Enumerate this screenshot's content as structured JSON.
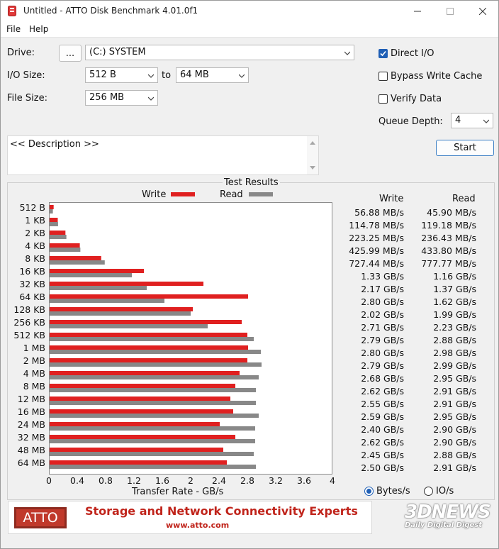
{
  "window": {
    "title": "Untitled - ATTO Disk Benchmark 4.01.0f1"
  },
  "menu": [
    "File",
    "Help"
  ],
  "settings": {
    "drive_label": "Drive:",
    "drive_browse": "...",
    "drive_value": "(C:) SYSTEM",
    "io_size_label": "I/O Size:",
    "io_from": "512 B",
    "io_to_label": "to",
    "io_to": "64 MB",
    "file_size_label": "File Size:",
    "file_size": "256 MB",
    "direct_io": "Direct I/O",
    "bypass_write_cache": "Bypass Write Cache",
    "verify_data": "Verify Data",
    "queue_depth_label": "Queue Depth:",
    "queue_depth": "4",
    "start": "Start",
    "description": "<< Description >>"
  },
  "results": {
    "title": "Test Results",
    "write_col": "Write",
    "read_col": "Read",
    "legend_write": "Write",
    "legend_read": "Read",
    "write_color": "#e02020",
    "read_color": "#888888",
    "x_label": "Transfer Rate - GB/s",
    "units_bytes": "Bytes/s",
    "units_io": "IO/s"
  },
  "chart_data": {
    "type": "bar",
    "orientation": "horizontal",
    "xlim": [
      0,
      4
    ],
    "xticks": [
      "0",
      "0.4",
      "0.8",
      "1.2",
      "1.6",
      "2",
      "2.4",
      "2.8",
      "3.2",
      "3.6",
      "4"
    ],
    "xlabel": "Transfer Rate - GB/s",
    "categories": [
      "512 B",
      "1 KB",
      "2 KB",
      "4 KB",
      "8 KB",
      "16 KB",
      "32 KB",
      "64 KB",
      "128 KB",
      "256 KB",
      "512 KB",
      "1 MB",
      "2 MB",
      "4 MB",
      "8 MB",
      "12 MB",
      "16 MB",
      "24 MB",
      "32 MB",
      "48 MB",
      "64 MB"
    ],
    "series": [
      {
        "name": "Write",
        "values": [
          0.05688,
          0.11478,
          0.22325,
          0.42599,
          0.72744,
          1.33,
          2.17,
          2.8,
          2.02,
          2.71,
          2.79,
          2.8,
          2.79,
          2.68,
          2.62,
          2.55,
          2.59,
          2.4,
          2.62,
          2.45,
          2.5
        ],
        "labels": [
          "56.88 MB/s",
          "114.78 MB/s",
          "223.25 MB/s",
          "425.99 MB/s",
          "727.44 MB/s",
          "1.33 GB/s",
          "2.17 GB/s",
          "2.80 GB/s",
          "2.02 GB/s",
          "2.71 GB/s",
          "2.79 GB/s",
          "2.80 GB/s",
          "2.79 GB/s",
          "2.68 GB/s",
          "2.62 GB/s",
          "2.55 GB/s",
          "2.59 GB/s",
          "2.40 GB/s",
          "2.62 GB/s",
          "2.45 GB/s",
          "2.50 GB/s"
        ]
      },
      {
        "name": "Read",
        "values": [
          0.0459,
          0.11918,
          0.23643,
          0.4338,
          0.77777,
          1.16,
          1.37,
          1.62,
          1.99,
          2.23,
          2.88,
          2.98,
          2.99,
          2.95,
          2.91,
          2.91,
          2.95,
          2.9,
          2.9,
          2.88,
          2.91
        ],
        "labels": [
          "45.90 MB/s",
          "119.18 MB/s",
          "236.43 MB/s",
          "433.80 MB/s",
          "777.77 MB/s",
          "1.16 GB/s",
          "1.37 GB/s",
          "1.62 GB/s",
          "1.99 GB/s",
          "2.23 GB/s",
          "2.88 GB/s",
          "2.98 GB/s",
          "2.99 GB/s",
          "2.95 GB/s",
          "2.91 GB/s",
          "2.91 GB/s",
          "2.95 GB/s",
          "2.90 GB/s",
          "2.90 GB/s",
          "2.88 GB/s",
          "2.91 GB/s"
        ]
      }
    ]
  },
  "banner": {
    "logo": "ATTO",
    "slogan": "Storage and Network Connectivity Experts",
    "url": "www.atto.com"
  },
  "watermark": {
    "brand": "3DNEWS",
    "tagline": "Daily Digital Digest"
  }
}
